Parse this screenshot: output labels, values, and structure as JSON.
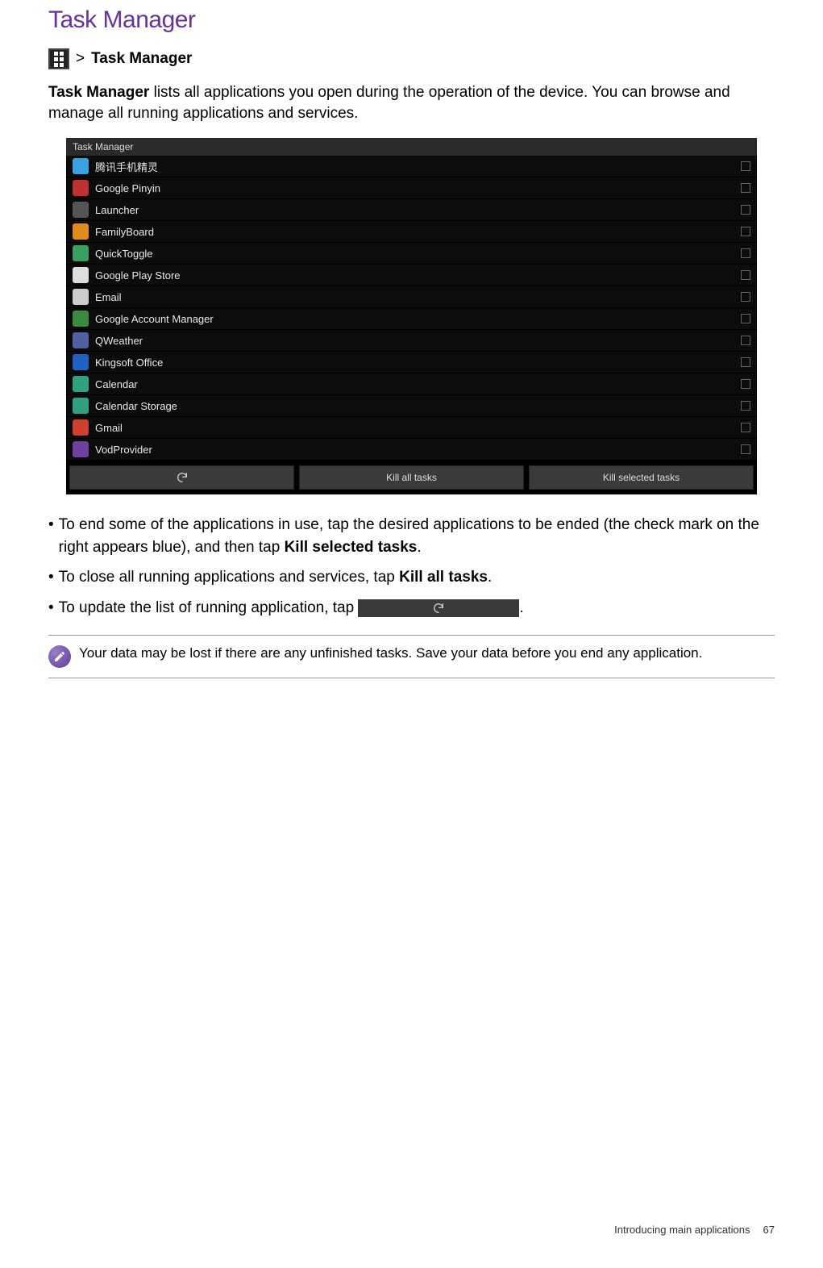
{
  "title": "Task Manager",
  "breadcrumb": {
    "sep": ">",
    "label": "Task Manager"
  },
  "intro": {
    "bold": "Task Manager",
    "rest": " lists all applications you open during the operation of the device. You can browse and manage all running applications and services."
  },
  "shot": {
    "header": "Task Manager",
    "tasks": [
      {
        "name": "腾讯手机精灵",
        "color": "#3aa0e0"
      },
      {
        "name": "Google Pinyin",
        "color": "#c03030"
      },
      {
        "name": "Launcher",
        "color": "#555"
      },
      {
        "name": "FamilyBoard",
        "color": "#e08a20"
      },
      {
        "name": "QuickToggle",
        "color": "#3aa060"
      },
      {
        "name": "Google Play Store",
        "color": "#ddd"
      },
      {
        "name": "Email",
        "color": "#ccc"
      },
      {
        "name": "Google Account Manager",
        "color": "#3a8a40"
      },
      {
        "name": "QWeather",
        "color": "#5060a0"
      },
      {
        "name": "Kingsoft Office",
        "color": "#2060c0"
      },
      {
        "name": "Calendar",
        "color": "#30a080"
      },
      {
        "name": "Calendar Storage",
        "color": "#30a080"
      },
      {
        "name": "Gmail",
        "color": "#d04030"
      },
      {
        "name": "VodProvider",
        "color": "#7040a0"
      }
    ],
    "buttons": {
      "refresh": "",
      "killAll": "Kill all tasks",
      "killSelected": "Kill selected tasks"
    }
  },
  "bullets": {
    "b1a": "To end some of the applications in use, tap the desired applications to be ended (the check mark on the right appears blue), and then tap ",
    "b1b": "Kill selected tasks",
    "b1c": ".",
    "b2a": "To close all running applications and services, tap ",
    "b2b": "Kill all tasks",
    "b2c": ".",
    "b3a": "To update the list of running application, tap ",
    "b3c": "."
  },
  "note": "Your data may be lost if there are any unfinished tasks. Save your data before you end any application.",
  "footer": {
    "section": "Introducing main applications",
    "page": "67"
  }
}
